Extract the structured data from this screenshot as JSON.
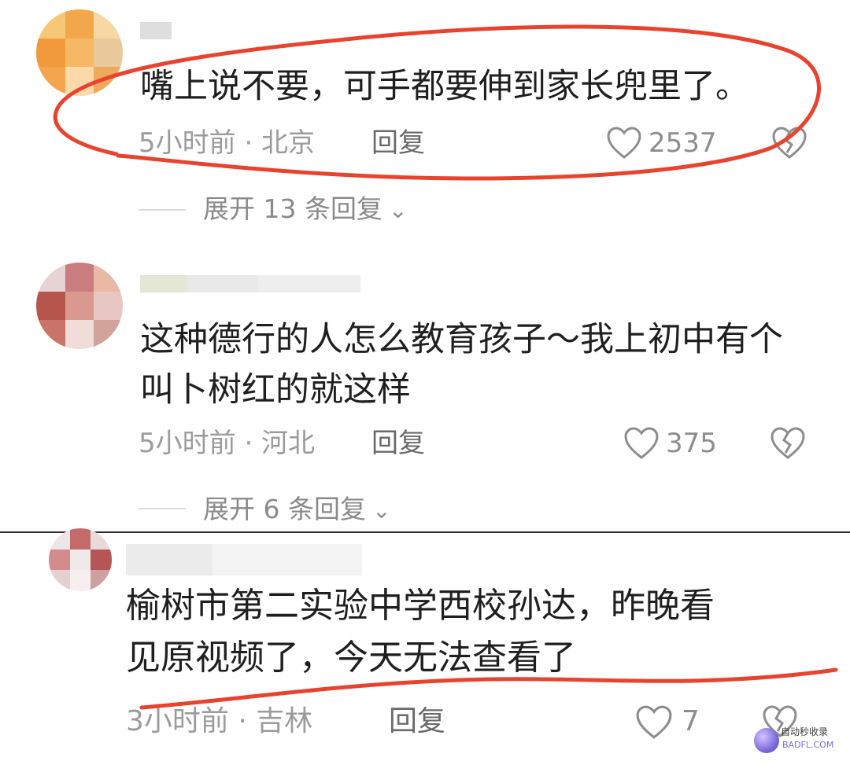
{
  "comments": [
    {
      "text": "嘴上说不要，可手都要伸到家长兜里了。",
      "meta": "5小时前 · 北京",
      "reply_label": "回复",
      "likes": "2537",
      "expand_label": "展开 13 条回复",
      "avatar_colors": [
        "#f6c777",
        "#f2a84a",
        "#f7d8a5",
        "#f09a3c",
        "#f5b965",
        "#e9c89a",
        "#f3a64e",
        "#fbd9a8",
        "#eea95a"
      ]
    },
    {
      "text": "这种德行的人怎么教育孩子～我上初中有个\n叫卜树红的就这样",
      "meta": "5小时前 · 河北",
      "reply_label": "回复",
      "likes": "375",
      "expand_label": "展开 6 条回复",
      "avatar_colors": [
        "#e7d2d4",
        "#c97d7f",
        "#eab8a6",
        "#b5554c",
        "#d9998f",
        "#e8c7c2",
        "#c87468",
        "#f0dcd8",
        "#d2a39a"
      ]
    },
    {
      "text": "榆树市第二实验中学西校孙达，昨晚看\n见原视频了，今天无法查看了",
      "meta": "3小时前 · 吉林",
      "reply_label": "回复",
      "likes": "7",
      "avatar_colors": [
        "#ede6e6",
        "#c46a6a",
        "#e9dada",
        "#d38b8b",
        "#f2eaea",
        "#b55555",
        "#e4d0d0",
        "#f5efef",
        "#cfa0a0"
      ]
    }
  ],
  "watermark": {
    "line1": "自动秒收录",
    "line2": "BADFL.COM"
  },
  "colors": {
    "annotation_red": "#e8432f",
    "text": "#1f1f1f",
    "meta": "#9b9b9b"
  }
}
